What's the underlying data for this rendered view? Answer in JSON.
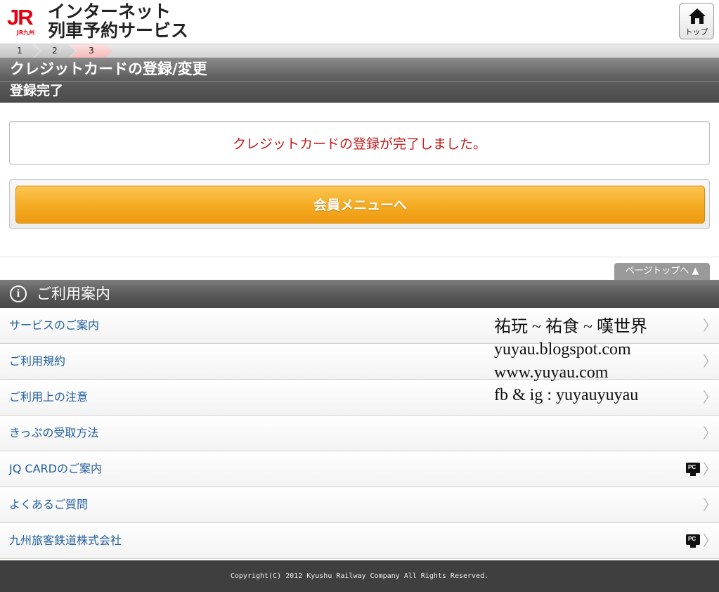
{
  "header": {
    "logo_text": "JR",
    "logo_sub": "JR九州",
    "title_line1": "インターネット",
    "title_line2": "列車予約サービス",
    "top_button_label": "トップ"
  },
  "steps": [
    "1",
    "2",
    "3"
  ],
  "current_step": "3",
  "page": {
    "title": "クレジットカードの登録/変更",
    "subtitle": "登録完了",
    "message": "クレジットカードの登録が完了しました。",
    "member_button": "会員メニューへ",
    "page_top_link": "ページトップへ ▲"
  },
  "guide": {
    "title": "ご利用案内",
    "items": [
      {
        "label": "サービスのご案内",
        "pc": false
      },
      {
        "label": "ご利用規約",
        "pc": false
      },
      {
        "label": "ご利用上の注意",
        "pc": false
      },
      {
        "label": "きっぷの受取方法",
        "pc": false
      },
      {
        "label": "JQ CARDのご案内",
        "pc": true
      },
      {
        "label": "よくあるご質問",
        "pc": false
      },
      {
        "label": "九州旅客鉄道株式会社",
        "pc": true
      }
    ],
    "pc_badge": "PC"
  },
  "watermark": [
    "祐玩 ~ 祐食 ~ 嘆世界",
    "yuyau.blogspot.com",
    "www.yuyau.com",
    "fb & ig : yuyauyuyau"
  ],
  "footer": {
    "copyright": "Copyright(C) 2012 Kyushu Railway Company All Rights Reserved."
  },
  "colors": {
    "brand_red": "#e60012",
    "message_red": "#c41a1a",
    "button_orange": "#f4aa20",
    "link_blue": "#1f5e9c",
    "header_gray": "#5f5f5f"
  }
}
